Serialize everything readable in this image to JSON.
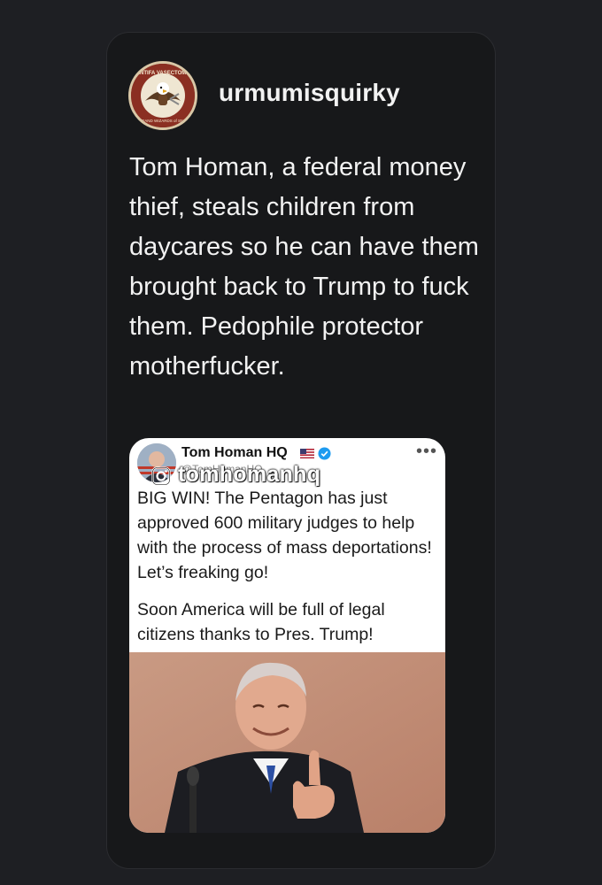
{
  "post": {
    "username": "urmumisquirky",
    "avatar_icon": "antifa-vasectomy-clinic-eagle-logo",
    "avatar_logo_text": "ANTIFA VASECTOMY CLINIC",
    "avatar_logo_subtext": "GRAND WIZARDS of SNIP",
    "text": "Tom Homan, a federal money thief, steals children from daycares so he can have them brought back to Trump to fuck them. Pedophile protector motherfucker."
  },
  "embed": {
    "display_name": "Tom Homan HQ",
    "flag_icon": "us-flag-icon",
    "verified_icon": "verified-badge-icon",
    "more_icon": "more-dots-icon",
    "handle": "@TomHomanHQ",
    "watermark_icon": "instagram-icon",
    "watermark_handle": "tomhomanhq",
    "paragraph1": "BIG WIN! The Pentagon has just approved 600 military judges to help with the process of mass deportations! Let’s freaking go!",
    "paragraph2": "Soon America will be full of legal citizens thanks to Pres. Trump!",
    "photo": "man-in-suit-giving-thumbs-up-photo"
  },
  "colors": {
    "page_bg": "#1e1f23",
    "card_bg": "#17181a",
    "text": "#f2f2f2",
    "verified_blue": "#1d9bf0"
  }
}
